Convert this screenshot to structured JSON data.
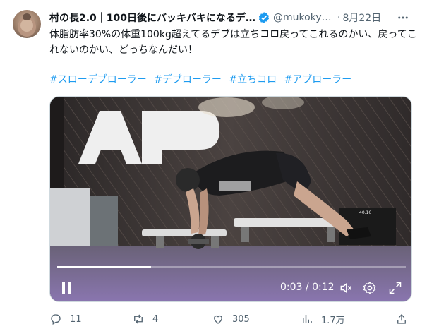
{
  "tweet": {
    "display_name": "村の長2.0｜100日後にバッキバキになるデ…",
    "handle": "@mukokyu…",
    "dot": "·",
    "date": "8月22日",
    "text": "体脂肪率30%の体重100kg超えてるデブは立ちコロ戻ってこれるのかい、戻ってこれないのかい、どっちなんだい！",
    "hashtags": [
      "#スローデブローラー",
      "#デブローラー",
      "#立ちコロ",
      "#アブローラー"
    ]
  },
  "video": {
    "current_time": "0:03",
    "separator": "/",
    "duration": "0:12",
    "progress": 0.27,
    "sign_text": "40.16"
  },
  "actions": {
    "replies": "11",
    "reposts": "4",
    "likes": "305",
    "views": "1.7万"
  },
  "colors": {
    "accent": "#1d9bf0",
    "muted": "#536471",
    "text": "#0f1419"
  },
  "icons": [
    "verified-badge-icon",
    "more-icon",
    "pause-icon",
    "mute-icon",
    "settings-icon",
    "fullscreen-icon",
    "reply-icon",
    "repost-icon",
    "like-icon",
    "views-icon",
    "share-icon"
  ]
}
